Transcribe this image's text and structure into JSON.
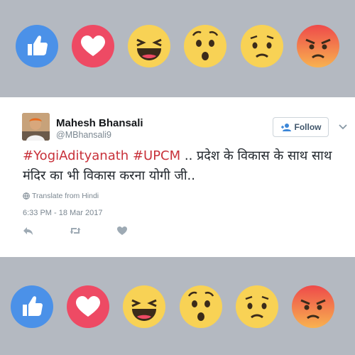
{
  "reactions": [
    "like",
    "love",
    "haha",
    "wow",
    "sad",
    "angry"
  ],
  "tweet": {
    "author_name": "Mahesh Bhansali",
    "handle": "@MBhansali9",
    "follow_label": "Follow",
    "hashtags": [
      "#YogiAdityanath",
      "#UPCM"
    ],
    "text": ".. प्रदेश के विकास के साथ साथ मंदिर का भी विकास करना योगी जी..",
    "translate_label": "Translate from Hindi",
    "timestamp": "6:33 PM - 18 Mar 2017"
  },
  "colors": {
    "background": "#b4b9c1",
    "like": "#4b91e8",
    "love": "#ee4a64",
    "emoji": "#f8d255",
    "angry_top": "#ee4a4a",
    "hashtag": "#c8313a"
  },
  "icons": [
    "reply-icon",
    "retweet-icon",
    "like-heart-icon",
    "globe-icon",
    "follow-user-icon",
    "chevron-down-icon"
  ]
}
